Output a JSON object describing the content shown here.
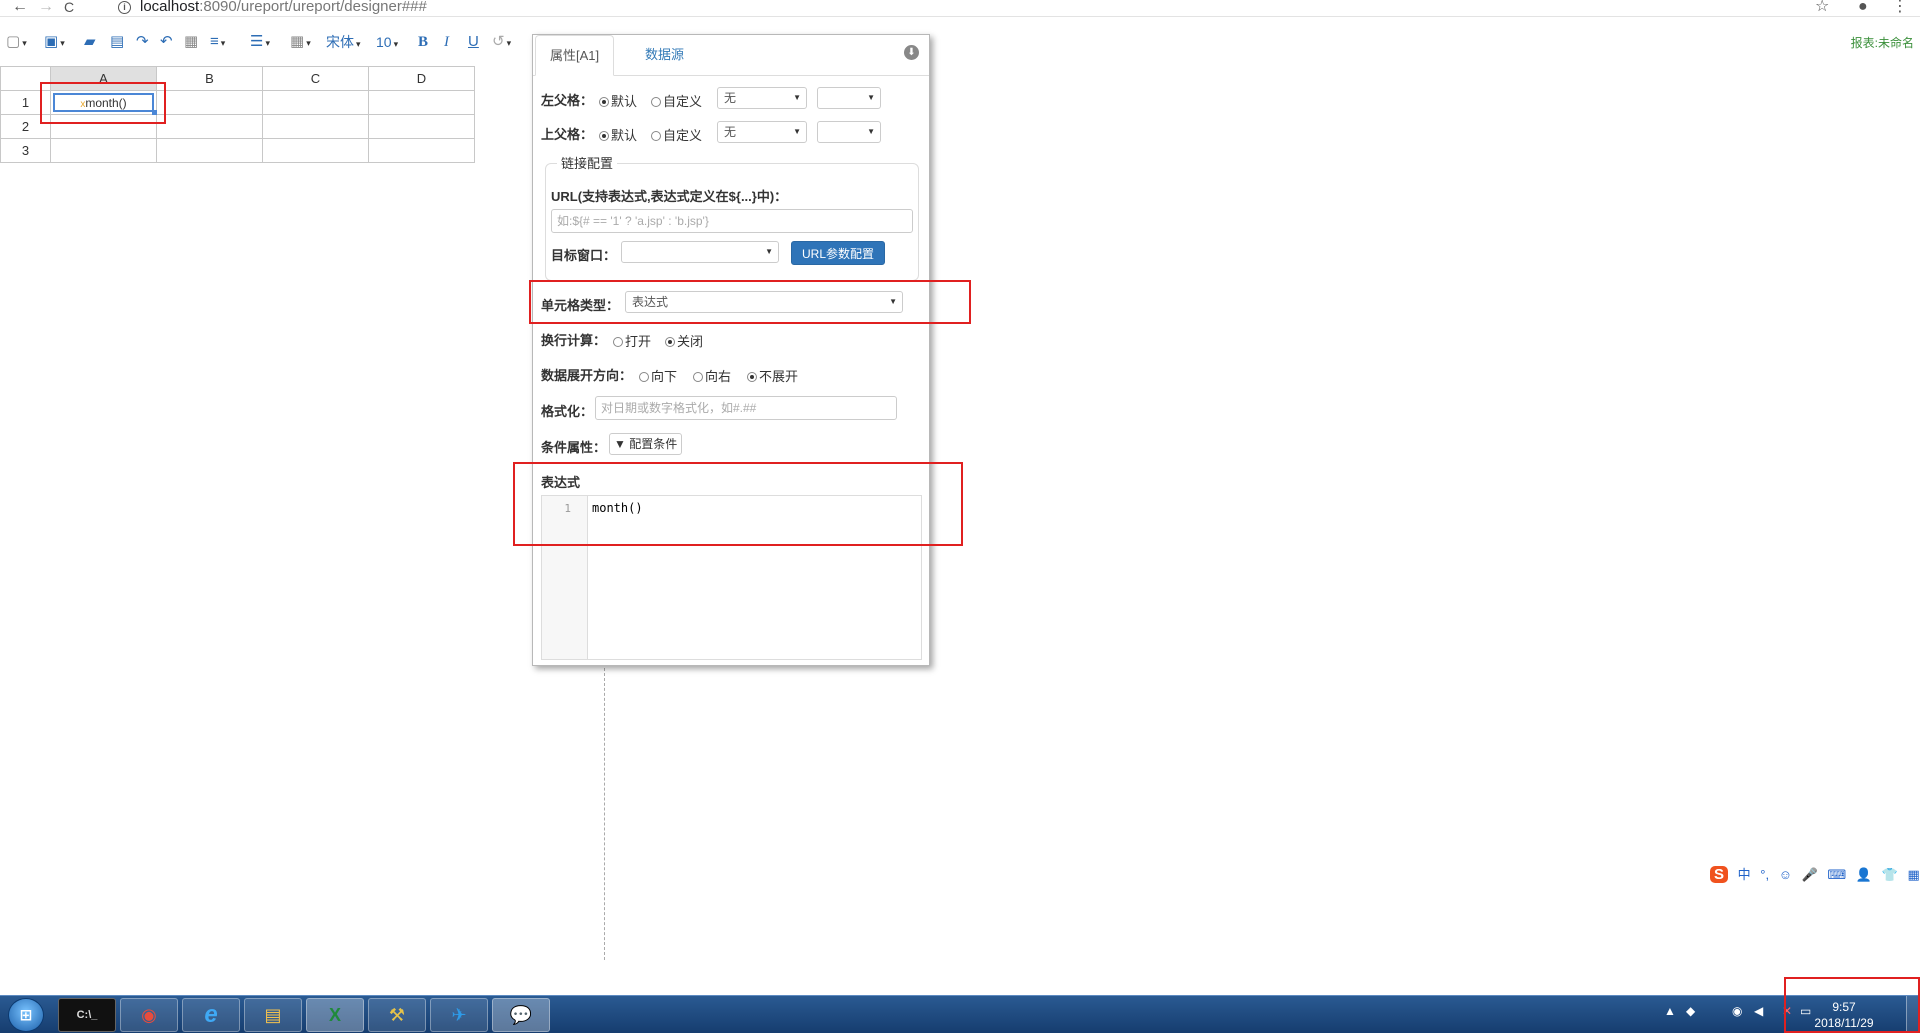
{
  "browser": {
    "back_icon": "←",
    "forward_icon": "→",
    "reload_icon": "C",
    "url_host": "localhost",
    "url_path": ":8090/ureport/ureport/designer###",
    "star_icon": "☆",
    "account_icon": "●",
    "menu_icon": "⋮"
  },
  "toolbar": {
    "font_name": "宋体",
    "font_size": "10",
    "bold": "B",
    "italic": "I",
    "underline": "U",
    "report_name": "报表:未命名"
  },
  "grid": {
    "columns": [
      "A",
      "B",
      "C",
      "D"
    ],
    "rows": [
      "1",
      "2",
      "3"
    ],
    "a1_marker": "x",
    "a1_value": "month()"
  },
  "panel": {
    "tab_properties": "属性[A1]",
    "tab_datasource": "数据源",
    "left_parent_label": "左父格：",
    "top_parent_label": "上父格：",
    "radio_default": "默认",
    "radio_custom": "自定义",
    "parent_select_value": "无",
    "link_legend": "链接配置",
    "url_label": "URL",
    "url_hint": "(支持表达式,表达式定义在${...}中)：",
    "url_placeholder": "如:${# == '1' ? 'a.jsp' : 'b.jsp'}",
    "target_window_label": "目标窗口：",
    "url_param_button": "URL参数配置",
    "cell_type_label": "单元格类型：",
    "cell_type_value": "表达式",
    "line_calc_label": "换行计算：",
    "radio_open": "打开",
    "radio_close": "关闭",
    "expand_dir_label": "数据展开方向：",
    "radio_down": "向下",
    "radio_right": "向右",
    "radio_none": "不展开",
    "format_label": "格式化：",
    "format_placeholder": "对日期或数字格式化，如#.##",
    "condition_label": "条件属性：",
    "condition_button": "配置条件",
    "expression_label": "表达式",
    "editor_line": "1",
    "editor_code": "month()"
  },
  "ime": [
    "中",
    "°,",
    "☺",
    "🎤",
    "⌨",
    "👤",
    "👕",
    "▦"
  ],
  "ime_logo": "S",
  "taskbar": {
    "start_label": "⊞",
    "apps": [
      "C:\\_",
      "◉",
      "e",
      "▤",
      "X",
      "⚒",
      "✈",
      "💬"
    ],
    "clock_time": "9:57",
    "clock_date": "2018/11/29"
  },
  "colors": {
    "accent": "#2d6db5",
    "highlight_red": "#e02020",
    "report_name": "#3a8f3a"
  }
}
